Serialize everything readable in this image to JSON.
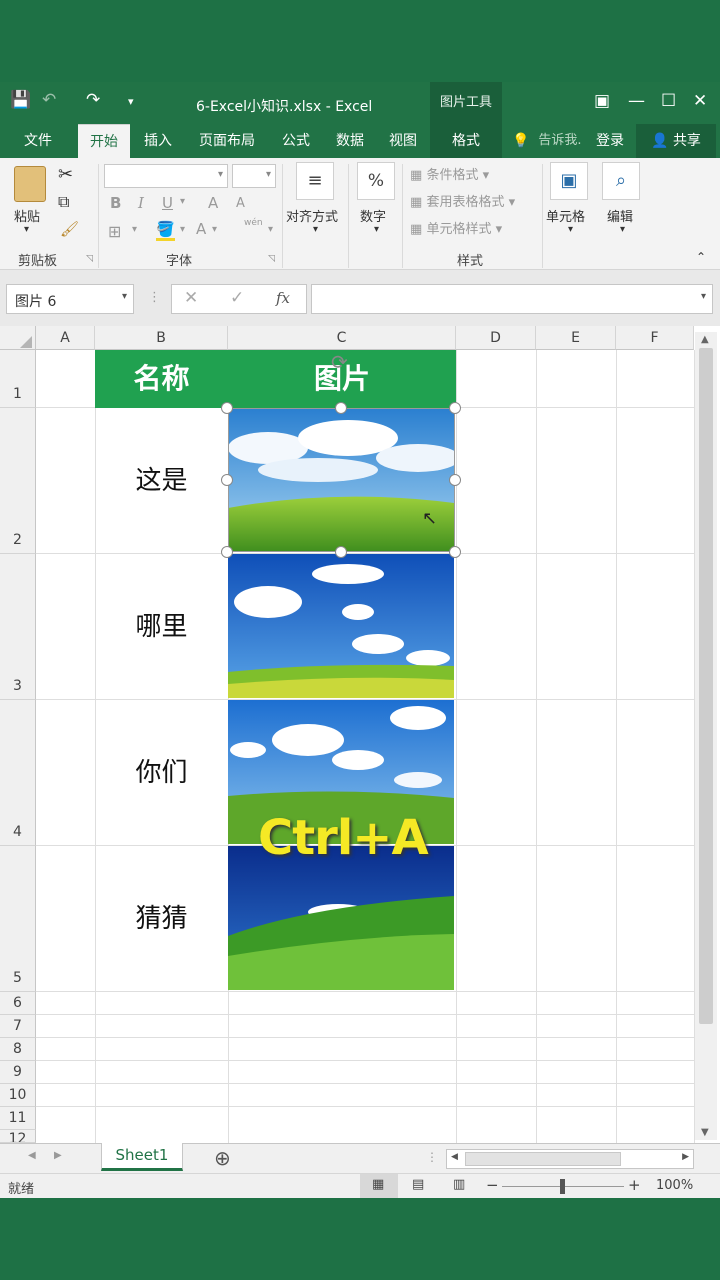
{
  "app": {
    "title": "6-Excel小知识.xlsx - Excel",
    "context_tab": "图片工具"
  },
  "tabs": [
    "文件",
    "开始",
    "插入",
    "页面布局",
    "公式",
    "数据",
    "视图",
    "格式"
  ],
  "tell_me": "告诉我.",
  "login": "登录",
  "share": "共享",
  "ribbon": {
    "paste": "粘贴",
    "clipboard": "剪贴板",
    "font": "字体",
    "bold": "B",
    "italic": "I",
    "underline": "U",
    "grow": "A",
    "shrink": "A",
    "wen": "wén",
    "align": "对齐方式",
    "number": "数字",
    "percent": "%",
    "cond_format": "条件格式",
    "table_format": "套用表格格式",
    "cell_style": "单元格样式",
    "styles": "样式",
    "cells": "单元格",
    "edit": "编辑"
  },
  "formula_bar": {
    "name_box": "图片 6",
    "fx": "fx",
    "value": ""
  },
  "columns": [
    "A",
    "B",
    "C",
    "D",
    "E",
    "F"
  ],
  "rows": [
    "1",
    "2",
    "3",
    "4",
    "5",
    "6",
    "7",
    "8",
    "9",
    "10",
    "11",
    "12"
  ],
  "table": {
    "header": {
      "name": "名称",
      "image": "图片"
    },
    "items": [
      "这是",
      "哪里",
      "你们",
      "猜猜"
    ]
  },
  "overlay_text": "Ctrl+A",
  "sheet": {
    "tab": "Sheet1",
    "add": "⊕"
  },
  "status": {
    "ready": "就绪",
    "zoom": "100%"
  }
}
